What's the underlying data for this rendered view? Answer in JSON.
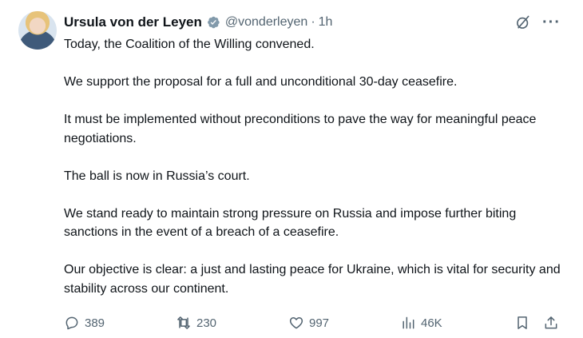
{
  "author": {
    "display_name": "Ursula von der Leyen",
    "handle": "@vonderleyen",
    "separator": "·",
    "time": "1h"
  },
  "icons": {
    "verified": "verified-badge-icon",
    "grok": "grok-icon",
    "more": "more-icon",
    "reply": "reply-icon",
    "retweet": "retweet-icon",
    "like": "heart-icon",
    "views": "analytics-icon",
    "bookmark": "bookmark-icon",
    "share": "share-icon"
  },
  "colors": {
    "verified": "#829aab",
    "muted": "#536471",
    "text": "#0f1419"
  },
  "tweet": {
    "paragraphs": [
      "Today, the Coalition of the Willing convened.",
      "We support the proposal for a full and unconditional 30-day ceasefire.",
      "It must be implemented without preconditions to pave the way for meaningful peace negotiations.",
      "The ball is now in Russia’s court.",
      "We stand ready to maintain strong pressure on Russia and impose further biting sanctions in the event of a breach of a ceasefire.",
      "Our objective is clear: a just and lasting peace for Ukraine, which is vital for security and stability across our continent."
    ]
  },
  "stats": {
    "replies": "389",
    "retweets": "230",
    "likes": "997",
    "views": "46K"
  }
}
